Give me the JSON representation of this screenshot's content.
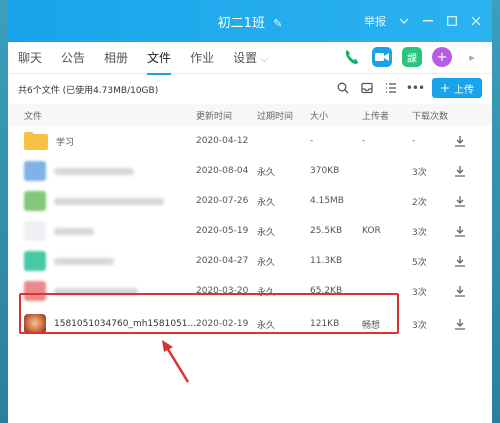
{
  "window": {
    "title": "初二1班",
    "report_label": "举报"
  },
  "tabs": [
    {
      "label": "聊天"
    },
    {
      "label": "公告"
    },
    {
      "label": "相册"
    },
    {
      "label": "文件"
    },
    {
      "label": "作业"
    },
    {
      "label": "设置"
    }
  ],
  "toolbar": {
    "summary": "共6个文件 (已使用4.73MB/10GB)",
    "upload_label": "上传"
  },
  "columns": {
    "name": "文件",
    "time": "更新时间",
    "expire": "过期时间",
    "size": "大小",
    "uploader": "上传者",
    "downloads": "下载次数"
  },
  "rows": [
    {
      "name": "学习",
      "time": "2020-04-12",
      "expire": "",
      "size": "-",
      "uploader": "-",
      "downloads": "-"
    },
    {
      "name": "",
      "time": "2020-08-04",
      "expire": "永久",
      "size": "370KB",
      "uploader": "",
      "downloads": "3次"
    },
    {
      "name": "",
      "time": "2020-07-26",
      "expire": "永久",
      "size": "4.15MB",
      "uploader": "",
      "downloads": "2次"
    },
    {
      "name": "",
      "time": "2020-05-19",
      "expire": "永久",
      "size": "25.5KB",
      "uploader": "KOR",
      "downloads": "3次"
    },
    {
      "name": "",
      "time": "2020-04-27",
      "expire": "永久",
      "size": "11.3KB",
      "uploader": "",
      "downloads": "5次"
    },
    {
      "name": "",
      "time": "2020-03-20",
      "expire": "永久",
      "size": "65.2KB",
      "uploader": "",
      "downloads": "3次"
    },
    {
      "name": "1581051034760_mh1581051...",
      "time": "2020-02-19",
      "expire": "永久",
      "size": "121KB",
      "uploader": "畅想",
      "downloads": "3次"
    }
  ],
  "colors": {
    "accent": "#1aa3ea",
    "highlight": "#d9342f"
  }
}
